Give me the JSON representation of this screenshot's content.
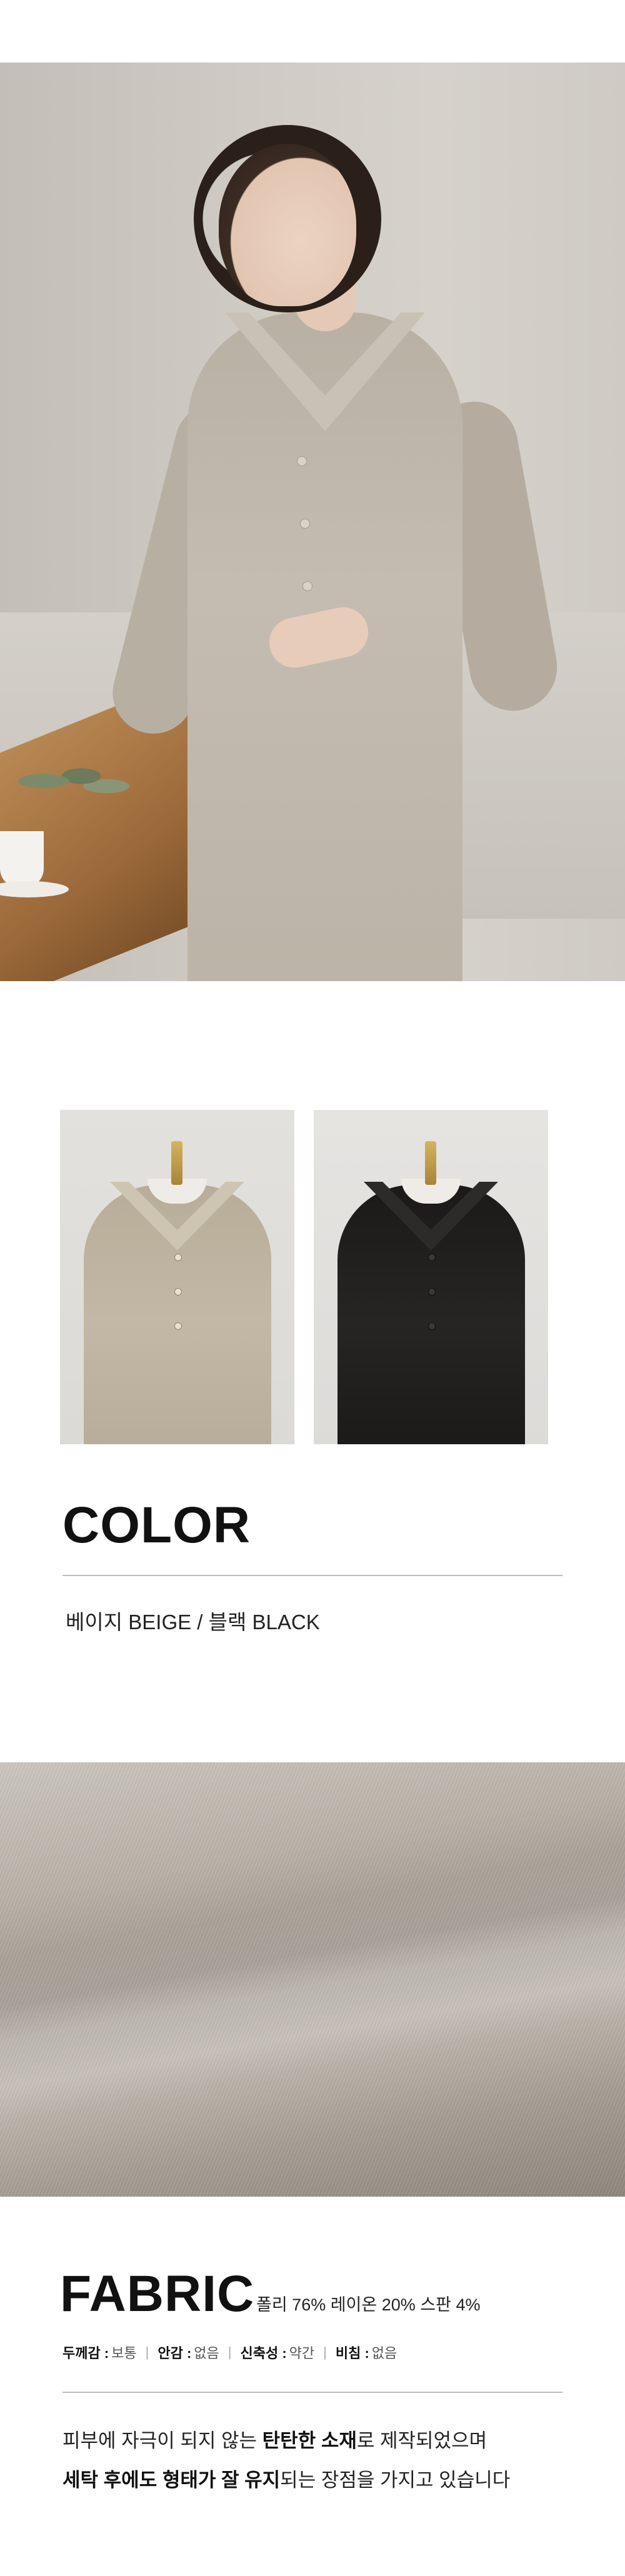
{
  "hero": {
    "alt": ""
  },
  "swatches": {
    "items": [
      {
        "name": "beige",
        "color": "#bdb39f"
      },
      {
        "name": "black",
        "color": "#1e1d1b"
      }
    ]
  },
  "color_section": {
    "title": "COLOR",
    "description": "베이지 BEIGE / 블랙 BLACK"
  },
  "fabric_section": {
    "title": "FABRIC",
    "composition": "폴리 76% 레이온 20% 스판 4%",
    "properties": [
      {
        "label": "두께감 :",
        "value": "보통"
      },
      {
        "label": "안감 :",
        "value": "없음"
      },
      {
        "label": "신축성 :",
        "value": "약간"
      },
      {
        "label": "비침 :",
        "value": "없음"
      }
    ],
    "separator": "|",
    "line1": {
      "pre": "피부에 자극이 되지 않는 ",
      "bold": "탄탄한 소재",
      "post": "로 제작되었으며"
    },
    "line2": {
      "bold": "세탁 후에도 형태가 잘 유지",
      "post": "되는 장점을 가지고 있습니다"
    }
  }
}
